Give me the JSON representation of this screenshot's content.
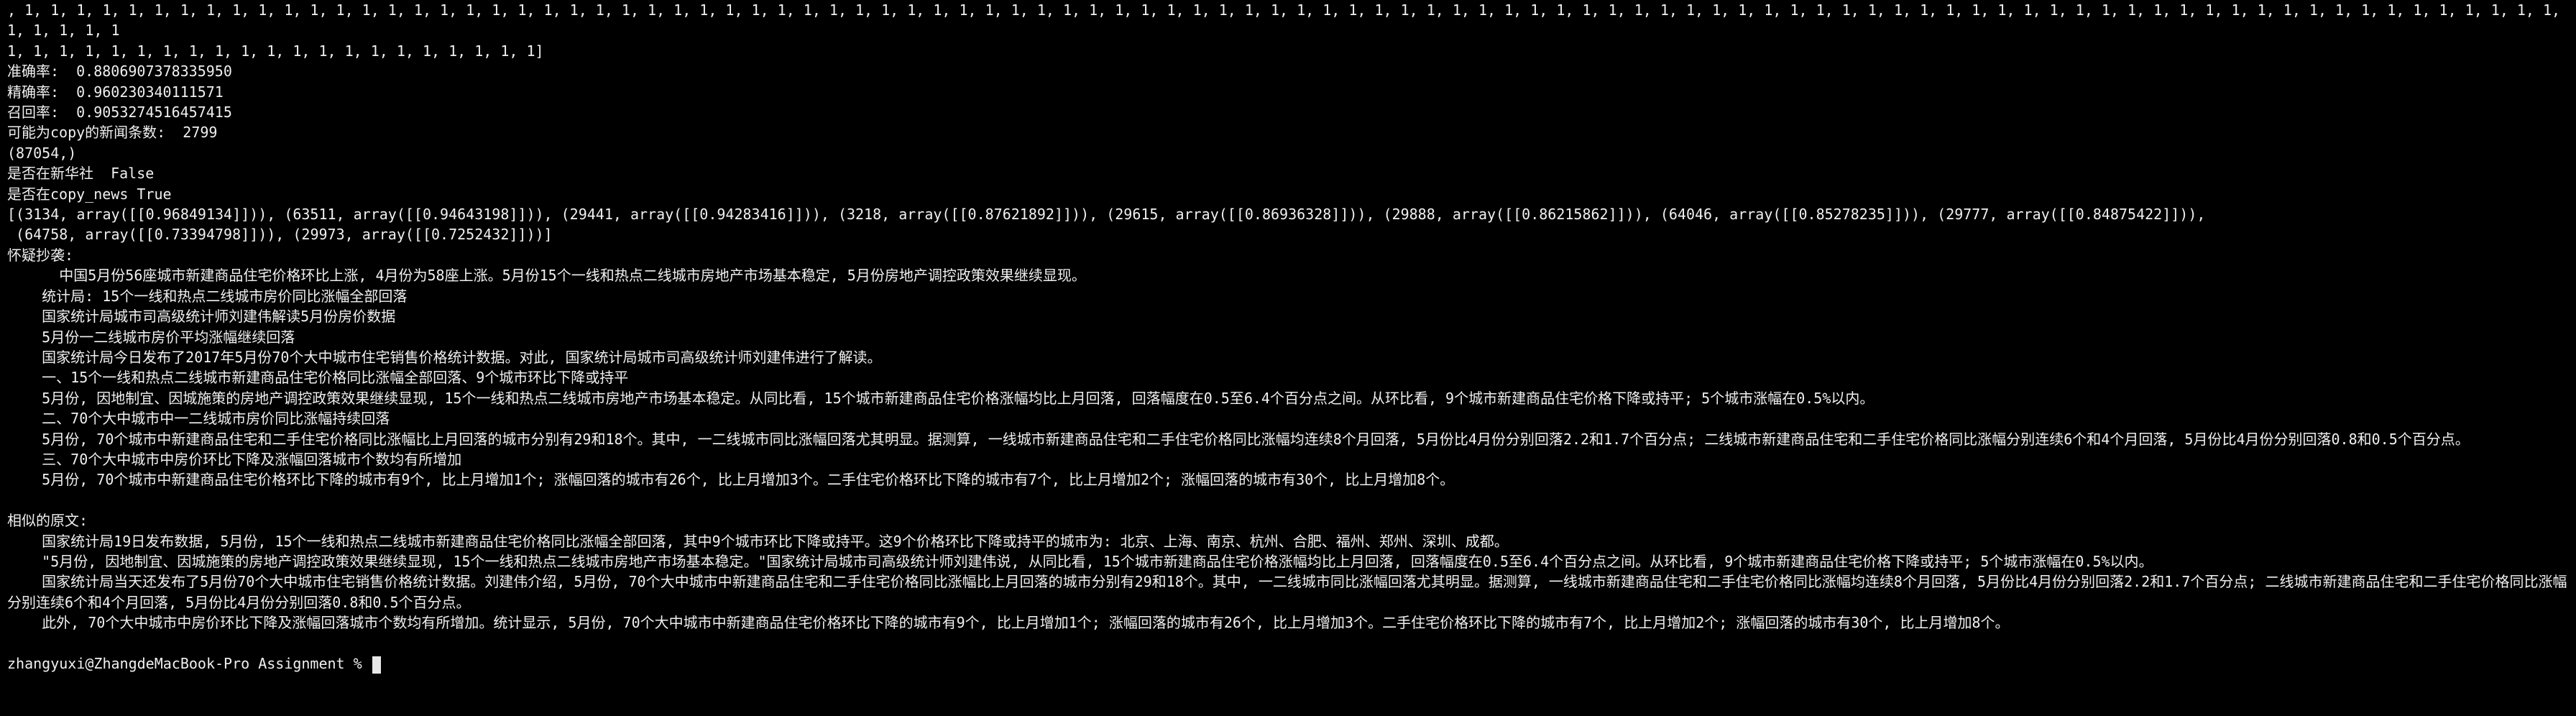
{
  "terminal": {
    "lines": [
      ", 1, 1, 1, 1, 1, 1, 1, 1, 1, 1, 1, 1, 1, 1, 1, 1, 1, 1, 1, 1, 1, 1, 1, 1, 1, 1, 1, 1, 1, 1, 1, 1, 1, 1, 1, 1, 1, 1, 1, 1, 1, 1, 1, 1, 1, 1, 1, 1, 1, 1, 1, 1, 1, 1, 1, 1, 1, 1, 1, 1, 1, 1, 1, 1, 1, 1, 1, 1, 1, 1, 1, 1, 1, 1, 1, 1, 1, 1, 1, 1, 1, 1, 1, 1, 1, 1, 1, 1, 1, 1, 1, 1, 1, 1, 1, 1, 1, 1, 1, 1, 1, 1, 1",
      "1, 1, 1, 1, 1, 1, 1, 1, 1, 1, 1, 1, 1, 1, 1, 1, 1, 1, 1, 1, 1]",
      "准确率:  0.8806907378335950",
      "精确率:  0.960230340111571",
      "召回率:  0.9053274516457415",
      "可能为copy的新闻条数:  2799",
      "(87054,)",
      "是否在新华社  False",
      "是否在copy_news True",
      "[(3134, array([[0.96849134]])), (63511, array([[0.94643198]])), (29441, array([[0.94283416]])), (3218, array([[0.87621892]])), (29615, array([[0.86936328]])), (29888, array([[0.86215862]])), (64046, array([[0.85278235]])), (29777, array([[0.84875422]])),",
      " (64758, array([[0.73394798]])), (29973, array([[0.7252432]]))]",
      "怀疑抄袭:",
      "      中国5月份56座城市新建商品住宅价格环比上涨, 4月份为58座上涨。5月份15个一线和热点二线城市房地产市场基本稳定, 5月份房地产调控政策效果继续显现。",
      "    统计局: 15个一线和热点二线城市房价同比涨幅全部回落",
      "    国家统计局城市司高级统计师刘建伟解读5月份房价数据",
      "    5月份一二线城市房价平均涨幅继续回落",
      "    国家统计局今日发布了2017年5月份70个大中城市住宅销售价格统计数据。对此, 国家统计局城市司高级统计师刘建伟进行了解读。",
      "    一、15个一线和热点二线城市新建商品住宅价格同比涨幅全部回落、9个城市环比下降或持平",
      "    5月份, 因地制宜、因城施策的房地产调控政策效果继续显现, 15个一线和热点二线城市房地产市场基本稳定。从同比看, 15个城市新建商品住宅价格涨幅均比上月回落, 回落幅度在0.5至6.4个百分点之间。从环比看, 9个城市新建商品住宅价格下降或持平; 5个城市涨幅在0.5%以内。",
      "    二、70个大中城市中一二线城市房价同比涨幅持续回落",
      "    5月份, 70个城市中新建商品住宅和二手住宅价格同比涨幅比上月回落的城市分别有29和18个。其中, 一二线城市同比涨幅回落尤其明显。据测算, 一线城市新建商品住宅和二手住宅价格同比涨幅均连续8个月回落, 5月份比4月份分别回落2.2和1.7个百分点; 二线城市新建商品住宅和二手住宅价格同比涨幅分别连续6个和4个月回落, 5月份比4月份分别回落0.8和0.5个百分点。",
      "    三、70个大中城市中房价环比下降及涨幅回落城市个数均有所增加",
      "    5月份, 70个城市中新建商品住宅价格环比下降的城市有9个, 比上月增加1个; 涨幅回落的城市有26个, 比上月增加3个。二手住宅价格环比下降的城市有7个, 比上月增加2个; 涨幅回落的城市有30个, 比上月增加8个。",
      "",
      "相似的原文:",
      "    国家统计局19日发布数据, 5月份, 15个一线和热点二线城市新建商品住宅价格同比涨幅全部回落, 其中9个城市环比下降或持平。这9个价格环比下降或持平的城市为: 北京、上海、南京、杭州、合肥、福州、郑州、深圳、成都。",
      "    \"5月份, 因地制宜、因城施策的房地产调控政策效果继续显现, 15个一线和热点二线城市房地产市场基本稳定。\"国家统计局城市司高级统计师刘建伟说, 从同比看, 15个城市新建商品住宅价格涨幅均比上月回落, 回落幅度在0.5至6.4个百分点之间。从环比看, 9个城市新建商品住宅价格下降或持平; 5个城市涨幅在0.5%以内。",
      "    国家统计局当天还发布了5月份70个大中城市住宅销售价格统计数据。刘建伟介绍, 5月份, 70个大中城市中新建商品住宅和二手住宅价格同比涨幅比上月回落的城市分别有29和18个。其中, 一二线城市同比涨幅回落尤其明显。据测算, 一线城市新建商品住宅和二手住宅价格同比涨幅均连续8个月回落, 5月份比4月份分别回落2.2和1.7个百分点; 二线城市新建商品住宅和二手住宅价格同比涨幅分别连续6个和4个月回落, 5月份比4月份分别回落0.8和0.5个百分点。",
      "    此外, 70个大中城市中房价环比下降及涨幅回落城市个数均有所增加。统计显示, 5月份, 70个大中城市中新建商品住宅价格环比下降的城市有9个, 比上月增加1个; 涨幅回落的城市有26个, 比上月增加3个。二手住宅价格环比下降的城市有7个, 比上月增加2个; 涨幅回落的城市有30个, 比上月增加8个。",
      ""
    ],
    "prompt": "zhangyuxi@ZhangdeMacBook-Pro Assignment % ",
    "colors": {
      "background": "#000000",
      "text": "#f0f0f0"
    }
  }
}
